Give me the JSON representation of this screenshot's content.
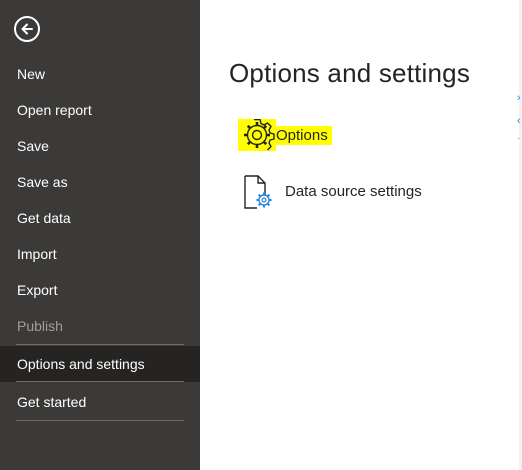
{
  "sidebar": {
    "back_icon": "back-arrow-icon",
    "items": [
      {
        "label": "New",
        "state": "normal"
      },
      {
        "label": "Open report",
        "state": "normal"
      },
      {
        "label": "Save",
        "state": "normal"
      },
      {
        "label": "Save as",
        "state": "normal"
      },
      {
        "label": "Get data",
        "state": "normal"
      },
      {
        "label": "Import",
        "state": "normal"
      },
      {
        "label": "Export",
        "state": "normal"
      },
      {
        "label": "Publish",
        "state": "disabled"
      },
      {
        "label": "Options and settings",
        "state": "active"
      },
      {
        "label": "Get started",
        "state": "normal"
      }
    ]
  },
  "main": {
    "title": "Options and settings",
    "options": [
      {
        "label": "Options",
        "icon": "gear-icon",
        "highlighted": true
      },
      {
        "label": "Data source settings",
        "icon": "data-source-settings-icon",
        "highlighted": false
      }
    ]
  },
  "colors": {
    "sidebar_bg": "#3b3a39",
    "active_bg": "#252423",
    "highlight": "#ffff00",
    "text_dark": "#252423",
    "icon_accent": "#2b88d8"
  }
}
